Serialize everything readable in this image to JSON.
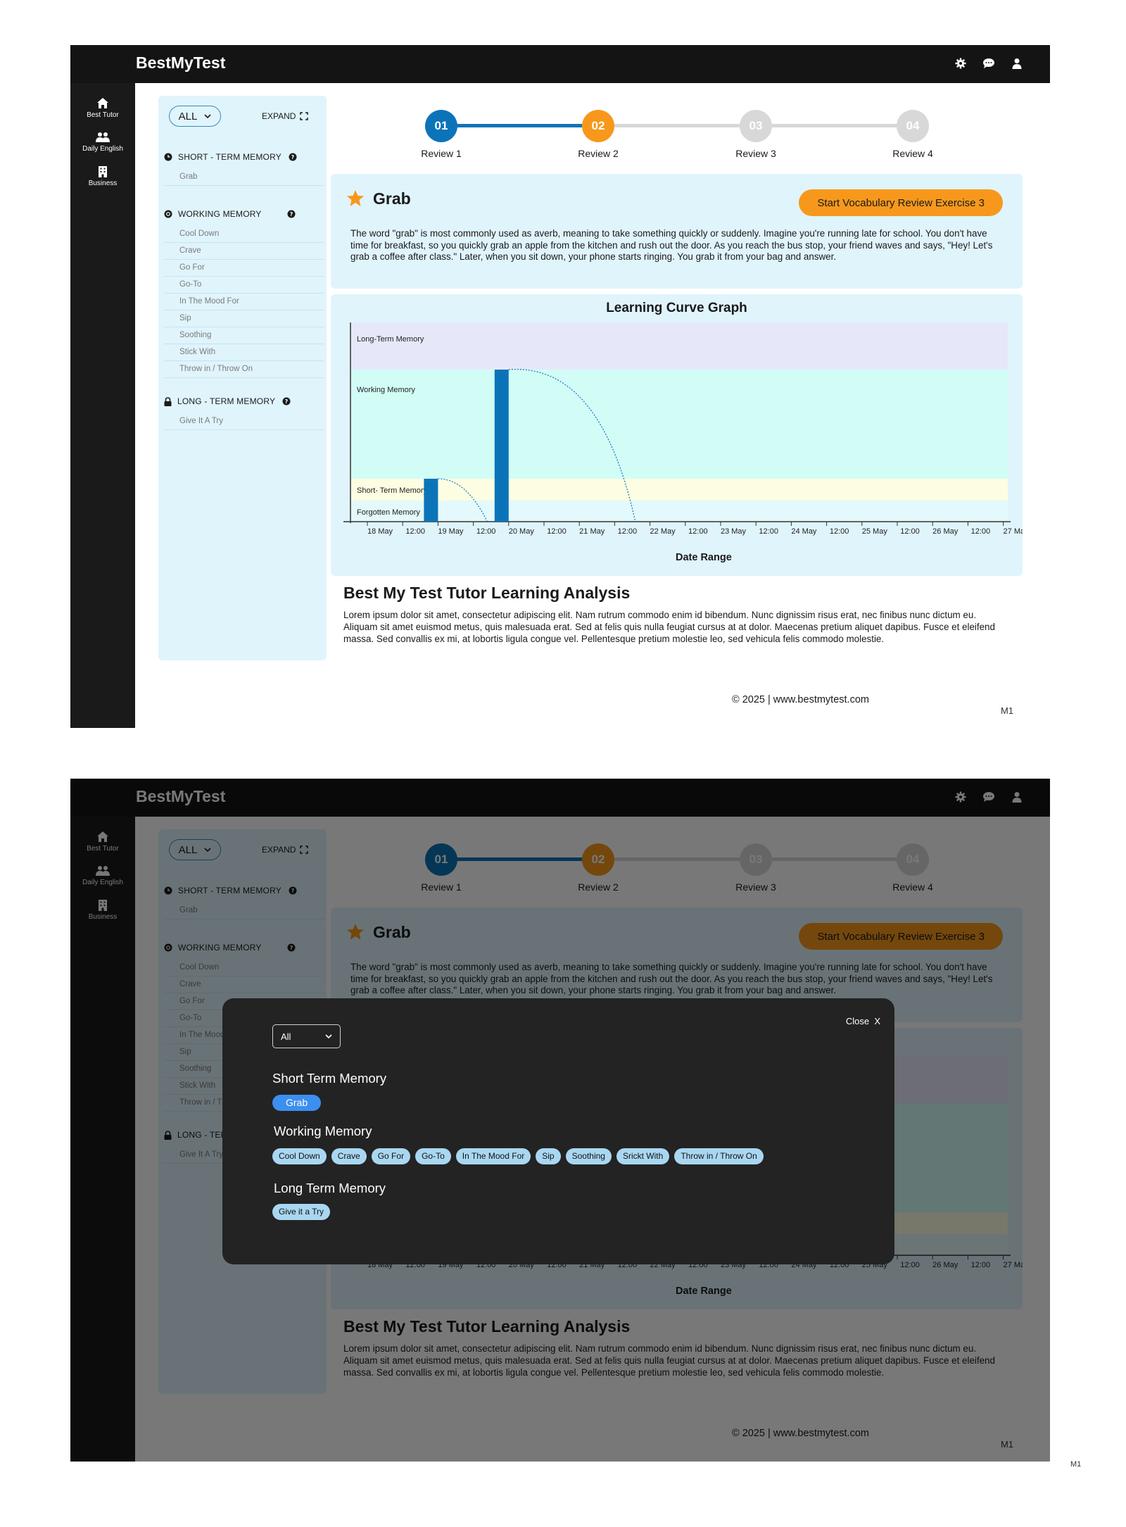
{
  "app": {
    "brand": "BestMyTest"
  },
  "header_icons": [
    "gear-icon",
    "chat-icon",
    "user-icon"
  ],
  "sidebar": {
    "items": [
      {
        "label": "Best Tutor",
        "icon": "home-icon"
      },
      {
        "label": "Daily English",
        "icon": "people-icon"
      },
      {
        "label": "Business",
        "icon": "building-icon"
      }
    ]
  },
  "word_panel": {
    "filter": "ALL",
    "expand_label": "EXPAND",
    "groups": [
      {
        "title": "SHORT - TERM MEMORY",
        "icon": "clock-icon",
        "words": [
          "Grab"
        ]
      },
      {
        "title": "WORKING MEMORY",
        "icon": "gear-icon",
        "words": [
          "Cool Down",
          "Crave",
          "Go For",
          "Go-To",
          "In The Mood For",
          "Sip",
          "Soothing",
          "Stick With",
          "Throw in / Throw On"
        ]
      },
      {
        "title": "LONG - TERM MEMORY",
        "icon": "lock-icon",
        "words": [
          "Give It A Try"
        ]
      }
    ]
  },
  "stepper": {
    "steps": [
      {
        "number": "01",
        "label": "Review 1",
        "state": "done"
      },
      {
        "number": "02",
        "label": "Review 2",
        "state": "current"
      },
      {
        "number": "03",
        "label": "Review 3",
        "state": "pending"
      },
      {
        "number": "04",
        "label": "Review 4",
        "state": "pending"
      }
    ],
    "colors": {
      "done": "#0b74b8",
      "current": "#f7981c",
      "pending": "#d8d8d8"
    }
  },
  "word_card": {
    "word": "Grab",
    "button_label": "Start Vocabulary Review Exercise 3",
    "description": "The word \"grab\" is most commonly used as averb, meaning to take something quickly or suddenly. Imagine you're running late for school. You don't have time for breakfast, so you quickly grab an apple from the kitchen and rush out the door. As you reach the bus stop, your friend waves and says, \"Hey! Let's grab a coffee after class.\" Later, when you sit down, your phone starts ringing. You grab it from your bag and answer."
  },
  "chart_data": {
    "type": "bar",
    "title": "Learning Curve Graph",
    "xlabel": "Date Range",
    "x_ticks": [
      "18 May",
      "12:00",
      "19 May",
      "12:00",
      "20 May",
      "12:00",
      "21 May",
      "12:00",
      "22 May",
      "12:00",
      "23 May",
      "12:00",
      "24 May",
      "12:00",
      "25 May",
      "12:00",
      "26 May",
      "12:00",
      "27 May"
    ],
    "zones": [
      {
        "label": "Long-Term Memory",
        "color": "#e6e8fa"
      },
      {
        "label": "Working Memory",
        "color": "#d2fdf7"
      },
      {
        "label": "Short- Term Memory",
        "color": "#fdfde2"
      },
      {
        "label": "Forgotten Memory",
        "color": "#e3f9fb"
      }
    ],
    "bars": [
      {
        "date": "19 May",
        "zone": "Short- Term Memory"
      },
      {
        "date": "20 May",
        "zone": "Working Memory"
      }
    ],
    "bar_color": "#0b74b8",
    "grid": false,
    "legend": "none"
  },
  "analysis": {
    "title": "Best My Test Tutor Learning Analysis",
    "text": "Lorem ipsum dolor sit amet, consectetur adipiscing elit. Nam rutrum commodo enim id bibendum. Nunc dignissim risus erat, nec finibus nunc dictum eu. Aliquam sit amet euismod metus, quis malesuada erat. Sed at felis quis nulla feugiat cursus at at dolor. Maecenas pretium aliquet dapibus. Fusce et eleifend massa. Sed convallis ex mi, at lobortis ligula congue vel. Pellentesque pretium molestie leo, sed vehicula felis commodo molestie."
  },
  "footer": {
    "copyright": "© 2025 | www.bestmytest.com",
    "code": "M1"
  },
  "modal": {
    "filter": "All",
    "close_label": "Close  X",
    "groups": [
      {
        "title": "Short Term Memory",
        "chips": [
          "Grab"
        ]
      },
      {
        "title": "Working Memory",
        "chips": [
          "Cool Down",
          "Crave",
          "Go For",
          "Go-To",
          "In The Mood For",
          "Sip",
          "Soothing",
          "Srickt With",
          "Throw in / Throw On"
        ]
      },
      {
        "title": "Long Term Memory",
        "chips": [
          "Give it a Try"
        ]
      }
    ]
  },
  "page_code": "M1"
}
